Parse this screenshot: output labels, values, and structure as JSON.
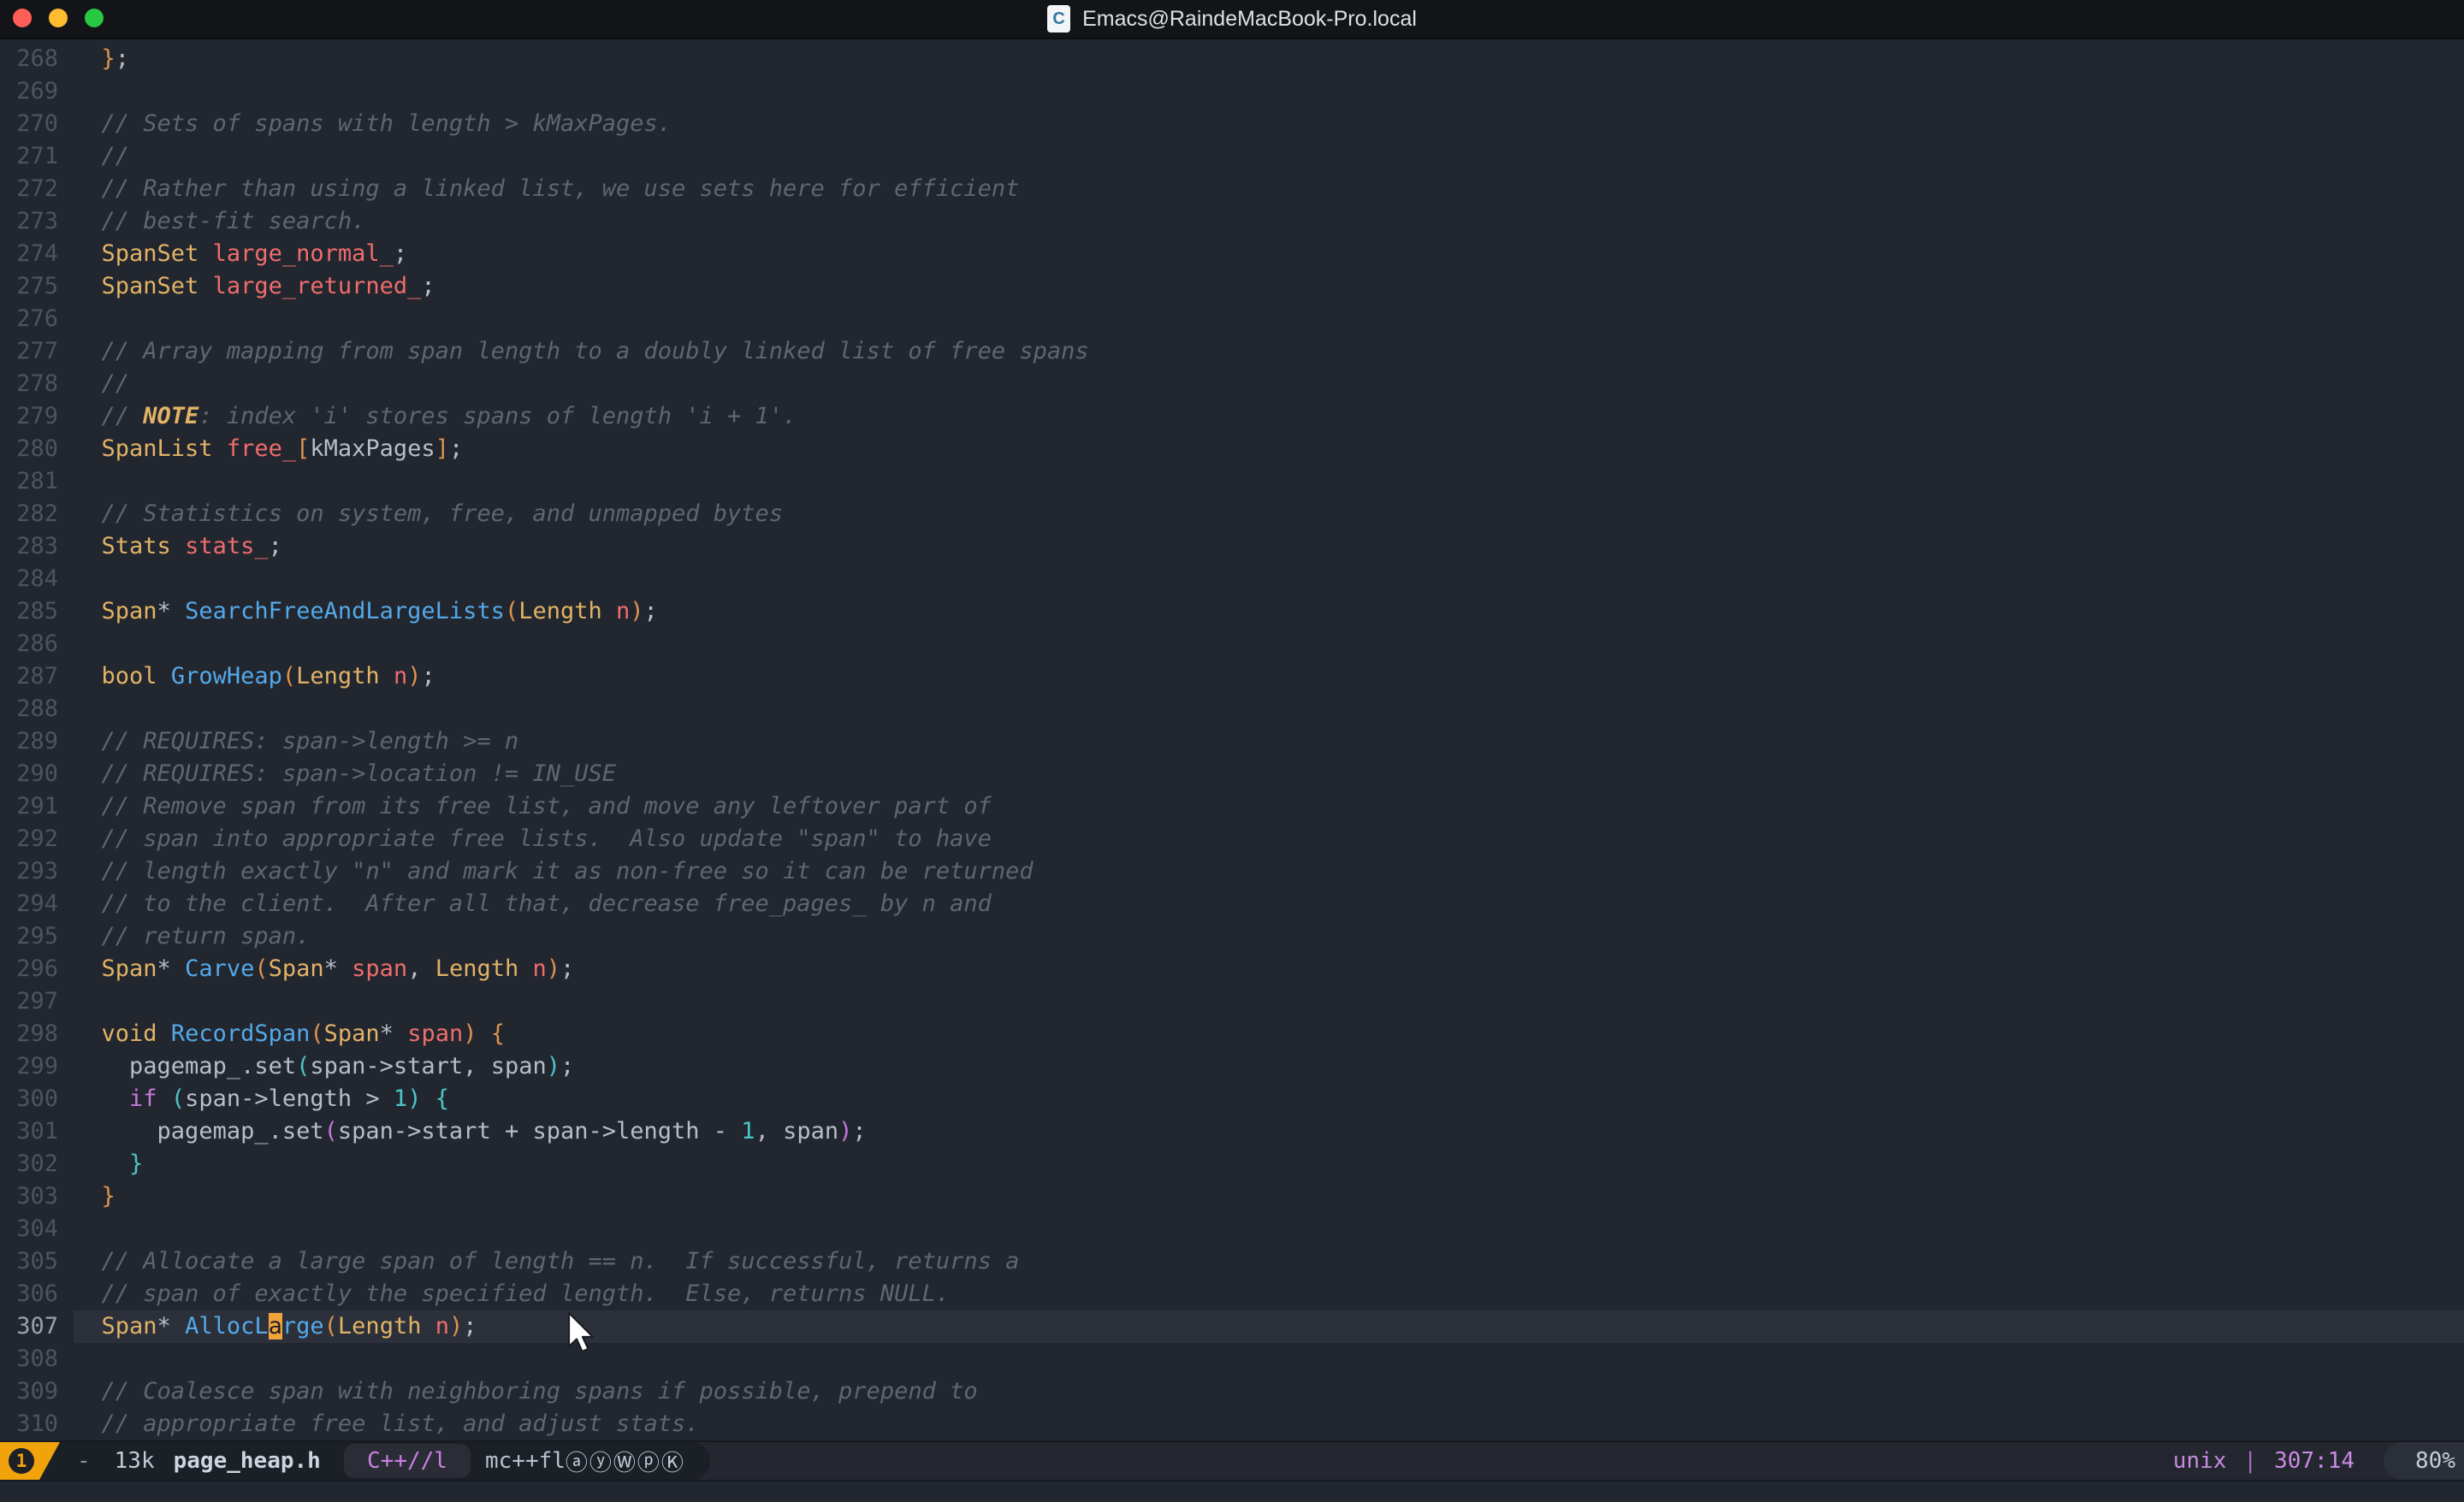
{
  "window": {
    "title": "Emacs@RaindeMacBook-Pro.local",
    "doc_icon_letter": "C"
  },
  "editor": {
    "current_line": 307,
    "cursor_position": "307:14",
    "lines": [
      {
        "n": "268",
        "segs": [
          [
            "  ",
            "fg"
          ],
          [
            "}",
            "d1"
          ],
          [
            ";",
            "fg"
          ]
        ]
      },
      {
        "n": "269",
        "segs": []
      },
      {
        "n": "270",
        "segs": [
          [
            "  ",
            "fg"
          ],
          [
            "// Sets of spans with length > kMaxPages.",
            "com"
          ]
        ]
      },
      {
        "n": "271",
        "segs": [
          [
            "  ",
            "fg"
          ],
          [
            "//",
            "com"
          ]
        ]
      },
      {
        "n": "272",
        "segs": [
          [
            "  ",
            "fg"
          ],
          [
            "// Rather than using a linked list, we use sets here for efficient",
            "com"
          ]
        ]
      },
      {
        "n": "273",
        "segs": [
          [
            "  ",
            "fg"
          ],
          [
            "// best-fit search.",
            "com"
          ]
        ]
      },
      {
        "n": "274",
        "segs": [
          [
            "  ",
            "fg"
          ],
          [
            "SpanSet",
            "typ"
          ],
          [
            " ",
            "fg"
          ],
          [
            "large_normal_",
            "var"
          ],
          [
            ";",
            "fg"
          ]
        ]
      },
      {
        "n": "275",
        "segs": [
          [
            "  ",
            "fg"
          ],
          [
            "SpanSet",
            "typ"
          ],
          [
            " ",
            "fg"
          ],
          [
            "large_returned_",
            "var"
          ],
          [
            ";",
            "fg"
          ]
        ]
      },
      {
        "n": "276",
        "segs": []
      },
      {
        "n": "277",
        "segs": [
          [
            "  ",
            "fg"
          ],
          [
            "// Array mapping from span length to a doubly linked list of free spans",
            "com"
          ]
        ]
      },
      {
        "n": "278",
        "segs": [
          [
            "  ",
            "fg"
          ],
          [
            "//",
            "com"
          ]
        ]
      },
      {
        "n": "279",
        "segs": [
          [
            "  ",
            "fg"
          ],
          [
            "// ",
            "com"
          ],
          [
            "NOTE",
            "cb"
          ],
          [
            ": index 'i' stores spans of length 'i + 1'.",
            "com"
          ]
        ]
      },
      {
        "n": "280",
        "segs": [
          [
            "  ",
            "fg"
          ],
          [
            "SpanList",
            "typ"
          ],
          [
            " ",
            "fg"
          ],
          [
            "free_",
            "var"
          ],
          [
            "[",
            "d1"
          ],
          [
            "kMaxPages",
            "fg"
          ],
          [
            "]",
            "d1"
          ],
          [
            ";",
            "fg"
          ]
        ]
      },
      {
        "n": "281",
        "segs": []
      },
      {
        "n": "282",
        "segs": [
          [
            "  ",
            "fg"
          ],
          [
            "// Statistics on system, free, and unmapped bytes",
            "com"
          ]
        ]
      },
      {
        "n": "283",
        "segs": [
          [
            "  ",
            "fg"
          ],
          [
            "Stats",
            "typ"
          ],
          [
            " ",
            "fg"
          ],
          [
            "stats_",
            "var"
          ],
          [
            ";",
            "fg"
          ]
        ]
      },
      {
        "n": "284",
        "segs": []
      },
      {
        "n": "285",
        "segs": [
          [
            "  ",
            "fg"
          ],
          [
            "Span",
            "typ"
          ],
          [
            "* ",
            "fg"
          ],
          [
            "SearchFreeAndLargeLists",
            "fn"
          ],
          [
            "(",
            "d1"
          ],
          [
            "Length",
            "typ"
          ],
          [
            " ",
            "fg"
          ],
          [
            "n",
            "var"
          ],
          [
            ")",
            "d1"
          ],
          [
            ";",
            "fg"
          ]
        ]
      },
      {
        "n": "286",
        "segs": []
      },
      {
        "n": "287",
        "segs": [
          [
            "  ",
            "fg"
          ],
          [
            "bool",
            "typ"
          ],
          [
            " ",
            "fg"
          ],
          [
            "GrowHeap",
            "fn"
          ],
          [
            "(",
            "d1"
          ],
          [
            "Length",
            "typ"
          ],
          [
            " ",
            "fg"
          ],
          [
            "n",
            "var"
          ],
          [
            ")",
            "d1"
          ],
          [
            ";",
            "fg"
          ]
        ]
      },
      {
        "n": "288",
        "segs": []
      },
      {
        "n": "289",
        "segs": [
          [
            "  ",
            "fg"
          ],
          [
            "// REQUIRES: span->length >= n",
            "com"
          ]
        ]
      },
      {
        "n": "290",
        "segs": [
          [
            "  ",
            "fg"
          ],
          [
            "// REQUIRES: span->location != IN_USE",
            "com"
          ]
        ]
      },
      {
        "n": "291",
        "segs": [
          [
            "  ",
            "fg"
          ],
          [
            "// Remove span from its free list, and move any leftover part of",
            "com"
          ]
        ]
      },
      {
        "n": "292",
        "segs": [
          [
            "  ",
            "fg"
          ],
          [
            "// span into appropriate free lists.  Also update \"span\" to have",
            "com"
          ]
        ]
      },
      {
        "n": "293",
        "segs": [
          [
            "  ",
            "fg"
          ],
          [
            "// length exactly \"n\" and mark it as non-free so it can be returned",
            "com"
          ]
        ]
      },
      {
        "n": "294",
        "segs": [
          [
            "  ",
            "fg"
          ],
          [
            "// to the client.  After all that, decrease free_pages_ by n and",
            "com"
          ]
        ]
      },
      {
        "n": "295",
        "segs": [
          [
            "  ",
            "fg"
          ],
          [
            "// return span.",
            "com"
          ]
        ]
      },
      {
        "n": "296",
        "segs": [
          [
            "  ",
            "fg"
          ],
          [
            "Span",
            "typ"
          ],
          [
            "* ",
            "fg"
          ],
          [
            "Carve",
            "fn"
          ],
          [
            "(",
            "d1"
          ],
          [
            "Span",
            "typ"
          ],
          [
            "* ",
            "fg"
          ],
          [
            "span",
            "var"
          ],
          [
            ", ",
            "fg"
          ],
          [
            "Length",
            "typ"
          ],
          [
            " ",
            "fg"
          ],
          [
            "n",
            "var"
          ],
          [
            ")",
            "d1"
          ],
          [
            ";",
            "fg"
          ]
        ]
      },
      {
        "n": "297",
        "segs": []
      },
      {
        "n": "298",
        "segs": [
          [
            "  ",
            "fg"
          ],
          [
            "void",
            "typ"
          ],
          [
            " ",
            "fg"
          ],
          [
            "RecordSpan",
            "fn"
          ],
          [
            "(",
            "d1"
          ],
          [
            "Span",
            "typ"
          ],
          [
            "* ",
            "fg"
          ],
          [
            "span",
            "var"
          ],
          [
            ")",
            "d1"
          ],
          [
            " ",
            "fg"
          ],
          [
            "{",
            "d1"
          ]
        ]
      },
      {
        "n": "299",
        "segs": [
          [
            "    ",
            "fg"
          ],
          [
            "pagemap_.set",
            "fg"
          ],
          [
            "(",
            "d2"
          ],
          [
            "span->start, span",
            "fg"
          ],
          [
            ")",
            "d2"
          ],
          [
            ";",
            "fg"
          ]
        ]
      },
      {
        "n": "300",
        "segs": [
          [
            "    ",
            "fg"
          ],
          [
            "if",
            "kw"
          ],
          [
            " ",
            "fg"
          ],
          [
            "(",
            "d2"
          ],
          [
            "span->length > ",
            "fg"
          ],
          [
            "1",
            "num"
          ],
          [
            ")",
            "d2"
          ],
          [
            " ",
            "fg"
          ],
          [
            "{",
            "d2"
          ]
        ]
      },
      {
        "n": "301",
        "segs": [
          [
            "      ",
            "fg"
          ],
          [
            "pagemap_.set",
            "fg"
          ],
          [
            "(",
            "d3"
          ],
          [
            "span->start + span->length - ",
            "fg"
          ],
          [
            "1",
            "num"
          ],
          [
            ", span",
            "fg"
          ],
          [
            ")",
            "d3"
          ],
          [
            ";",
            "fg"
          ]
        ]
      },
      {
        "n": "302",
        "segs": [
          [
            "    ",
            "fg"
          ],
          [
            "}",
            "d2"
          ]
        ]
      },
      {
        "n": "303",
        "segs": [
          [
            "  ",
            "fg"
          ],
          [
            "}",
            "d1"
          ]
        ]
      },
      {
        "n": "304",
        "segs": []
      },
      {
        "n": "305",
        "segs": [
          [
            "  ",
            "fg"
          ],
          [
            "// Allocate a large span of length == n.  If successful, returns a",
            "com"
          ]
        ]
      },
      {
        "n": "306",
        "segs": [
          [
            "  ",
            "fg"
          ],
          [
            "// span of exactly the specified length.  Else, returns NULL.",
            "com"
          ]
        ]
      },
      {
        "n": "307",
        "segs": [
          [
            "  ",
            "fg"
          ],
          [
            "Span",
            "typ"
          ],
          [
            "* ",
            "fg"
          ],
          [
            "AllocL",
            "fn"
          ],
          [
            "a",
            "cur"
          ],
          [
            "rge",
            "fn"
          ],
          [
            "(",
            "d1"
          ],
          [
            "Length",
            "typ"
          ],
          [
            " ",
            "fg"
          ],
          [
            "n",
            "var"
          ],
          [
            ")",
            "d1"
          ],
          [
            ";",
            "fg"
          ]
        ]
      },
      {
        "n": "308",
        "segs": []
      },
      {
        "n": "309",
        "segs": [
          [
            "  ",
            "fg"
          ],
          [
            "// Coalesce span with neighboring spans if possible, prepend to",
            "com"
          ]
        ]
      },
      {
        "n": "310",
        "segs": [
          [
            "  ",
            "fg"
          ],
          [
            "// appropriate free list, and adjust stats.",
            "com"
          ]
        ]
      }
    ]
  },
  "modeline": {
    "badge": "1",
    "buffer_state": "-",
    "file_size": "13k",
    "file_name": "page_heap.h",
    "major_mode": "C++//l",
    "minor_modes": "mc++fl",
    "minor_badges": "ⓐⓨⓌⓟⓀ",
    "eol": "unix",
    "separator": "|",
    "position": "307:14",
    "scroll": "80%"
  },
  "palette": {
    "editor_bg": "#22262f",
    "titlebar_bg": "#121418",
    "foreground": "#b7bec9",
    "comment": "#5e6673",
    "type_yellow": "#e2b366",
    "function_blue": "#54a9e9",
    "variable_red": "#ef6d6d",
    "keyword_magenta": "#c678dd",
    "teal": "#4cc7cb",
    "delimiter_orange": "#dd9450",
    "cursor_amber": "#f0a43c",
    "current_line_bg": "#2b303a",
    "modeline_badge": "#f0a30a",
    "modeline_violet": "#c88be0",
    "traffic_red": "#ff5f57",
    "traffic_yellow": "#febc2e",
    "traffic_green": "#28c840"
  }
}
